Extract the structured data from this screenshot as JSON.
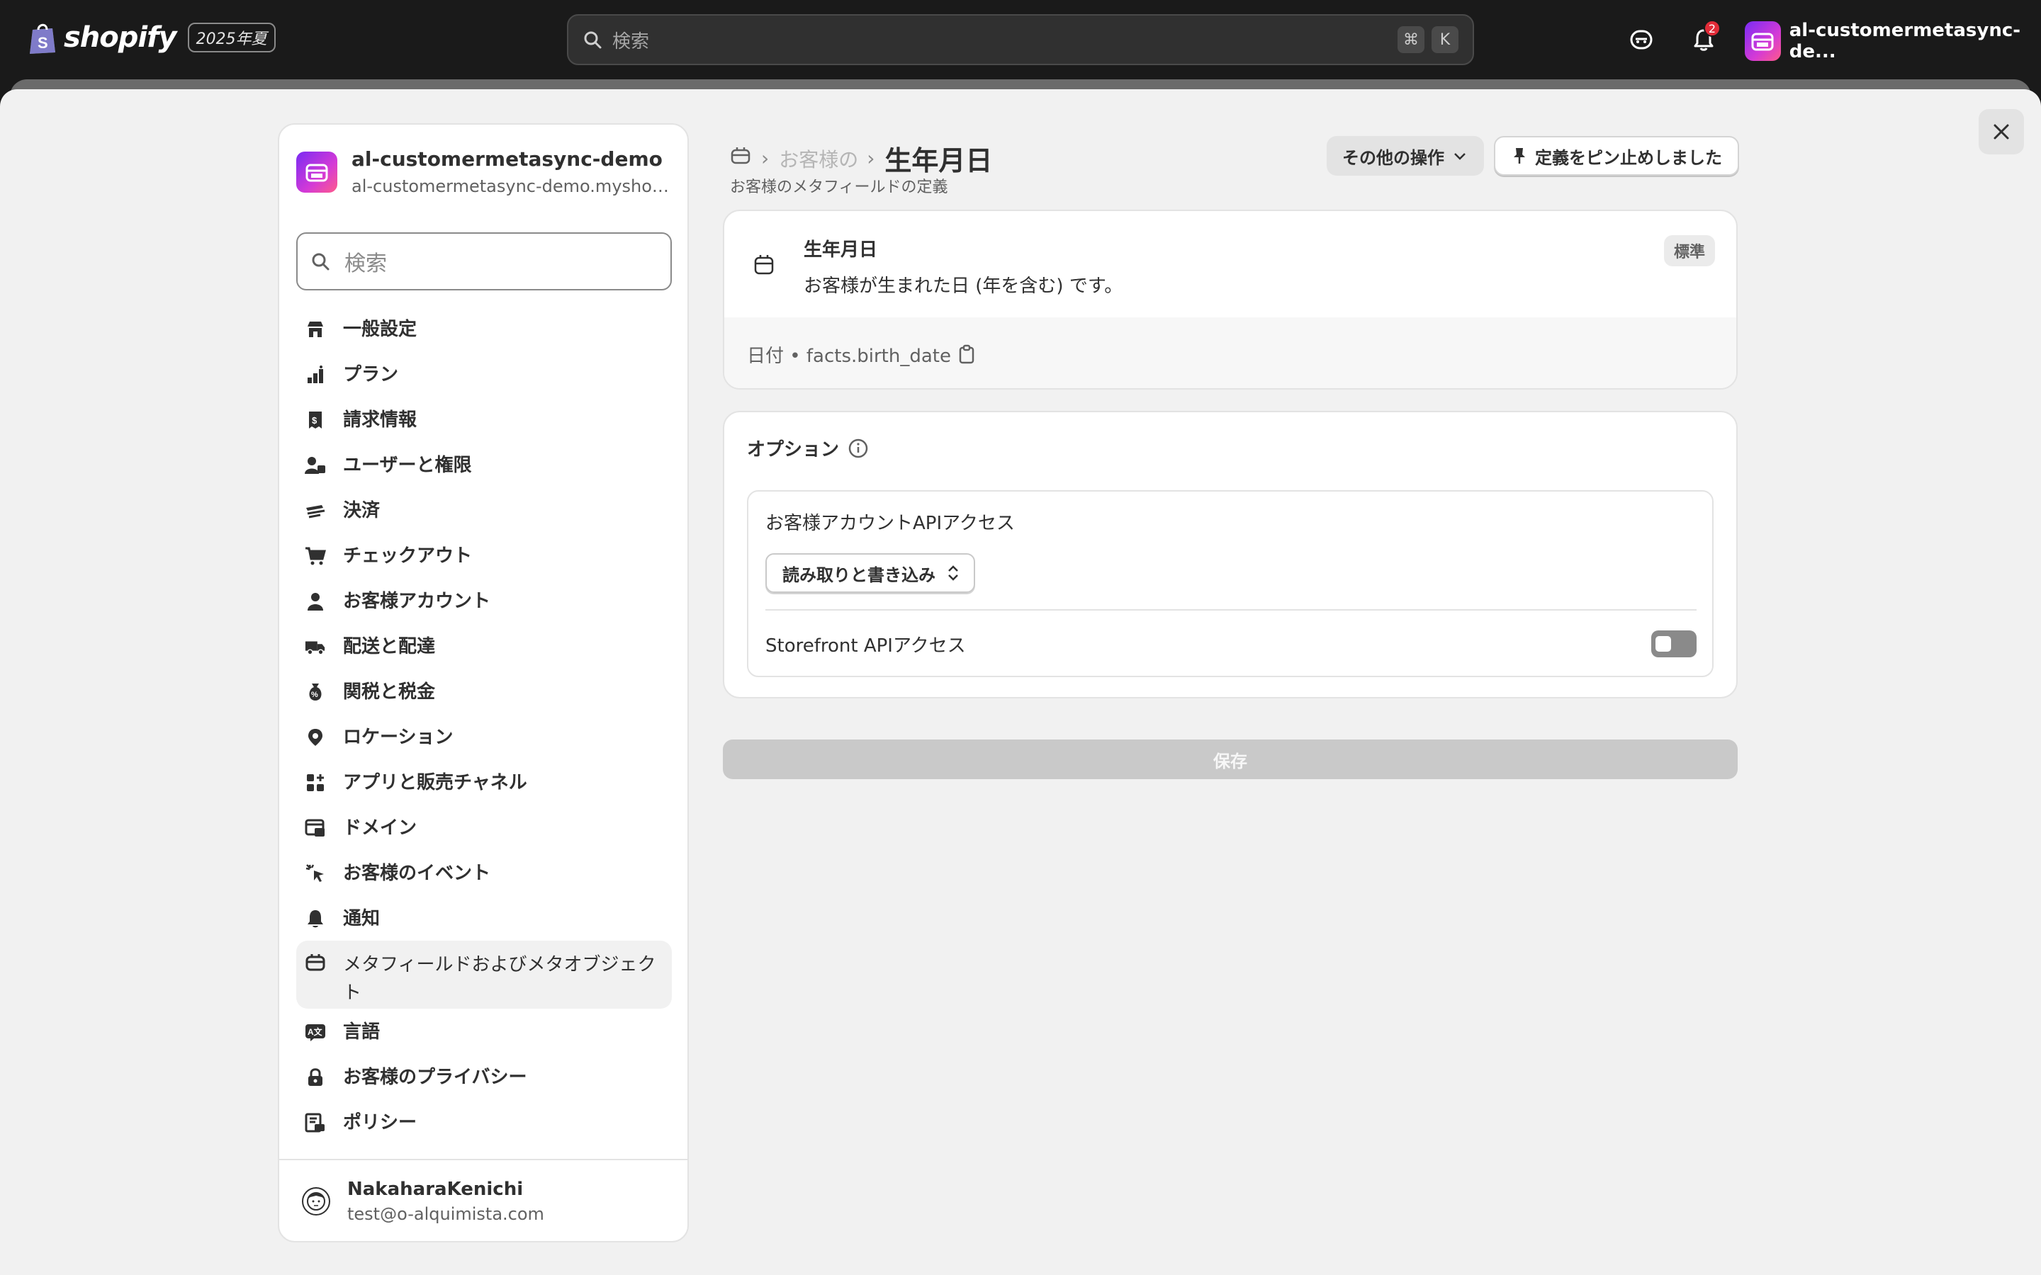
{
  "topbar": {
    "brand": "shopify",
    "edition": "2025年夏",
    "search_placeholder": "検索",
    "shortcut_cmd": "⌘",
    "shortcut_key": "K",
    "notification_count": "2",
    "store_name": "al-customermetasync-de..."
  },
  "sidebar": {
    "store_name": "al-customermetasync-demo",
    "store_domain": "al-customermetasync-demo.myshopi...",
    "search_placeholder": "検索",
    "items": [
      {
        "label": "一般設定",
        "icon": "store-icon"
      },
      {
        "label": "プラン",
        "icon": "plan-icon"
      },
      {
        "label": "請求情報",
        "icon": "receipt-icon"
      },
      {
        "label": "ユーザーと権限",
        "icon": "users-icon"
      },
      {
        "label": "決済",
        "icon": "payment-icon"
      },
      {
        "label": "チェックアウト",
        "icon": "cart-icon"
      },
      {
        "label": "お客様アカウント",
        "icon": "person-icon"
      },
      {
        "label": "配送と配達",
        "icon": "truck-icon"
      },
      {
        "label": "関税と税金",
        "icon": "tax-icon"
      },
      {
        "label": "ロケーション",
        "icon": "location-icon"
      },
      {
        "label": "アプリと販売チャネル",
        "icon": "apps-icon"
      },
      {
        "label": "ドメイン",
        "icon": "domain-icon"
      },
      {
        "label": "お客様のイベント",
        "icon": "cursor-icon"
      },
      {
        "label": "通知",
        "icon": "bell-icon"
      },
      {
        "label": "メタフィールドおよびメタオブジェクト",
        "icon": "metafield-icon"
      },
      {
        "label": "言語",
        "icon": "language-icon"
      },
      {
        "label": "お客様のプライバシー",
        "icon": "lock-icon"
      },
      {
        "label": "ポリシー",
        "icon": "policy-icon"
      }
    ],
    "user_name": "NakaharaKenichi",
    "user_email": "test@o-alquimista.com"
  },
  "main": {
    "breadcrumb_mid": "お客様のメタフィールド",
    "breadcrumb_current": "生年月日",
    "subtitle": "お客様のメタフィールドの定義",
    "more_actions": "その他の操作",
    "pin_button": "定義をピン止めしました",
    "definition": {
      "title": "生年月日",
      "description": "お客様が生まれた日 (年を含む) です。",
      "badge": "標準",
      "type_and_key": "日付 • facts.birth_date"
    },
    "options": {
      "title": "オプション",
      "customer_api_label": "お客様アカウントAPIアクセス",
      "customer_api_value": "読み取りと書き込み",
      "storefront_label": "Storefront APIアクセス",
      "storefront_enabled": false
    },
    "save_label": "保存"
  }
}
